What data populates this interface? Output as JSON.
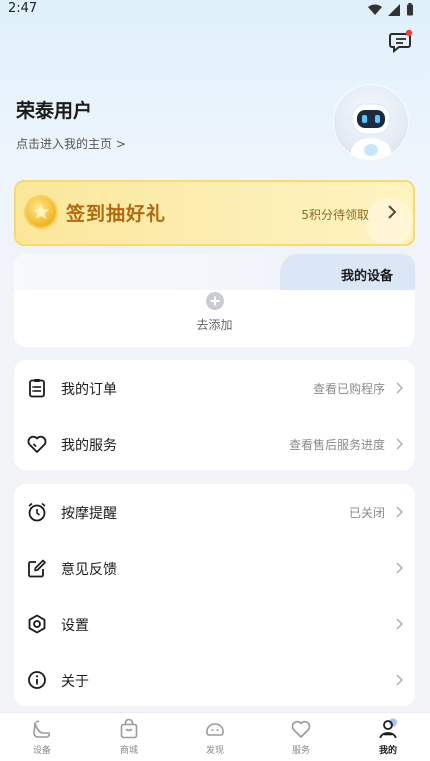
{
  "status_bar": {
    "time": "2:47"
  },
  "profile": {
    "name": "荣泰用户",
    "subtitle": "点击进入我的主页 >"
  },
  "signin": {
    "title": "签到抽好礼",
    "reward_text": "5积分待领取"
  },
  "devices": {
    "tab_label": "我的设备",
    "add_label": "去添加"
  },
  "group_orders": [
    {
      "label": "我的订单",
      "value": "查看已购程序",
      "icon": "clipboard-icon"
    },
    {
      "label": "我的服务",
      "value": "查看售后服务进度",
      "icon": "heart-icon"
    }
  ],
  "group_settings": [
    {
      "label": "按摩提醒",
      "value": "已关闭",
      "icon": "alarm-clock-icon"
    },
    {
      "label": "意见反馈",
      "value": "",
      "icon": "edit-icon"
    },
    {
      "label": "设置",
      "value": "",
      "icon": "hexagon-settings-icon"
    },
    {
      "label": "关于",
      "value": "",
      "icon": "info-icon"
    }
  ],
  "tabbar": [
    {
      "label": "设备",
      "icon": "device-icon"
    },
    {
      "label": "商城",
      "icon": "shop-bag-icon"
    },
    {
      "label": "发现",
      "icon": "discover-icon"
    },
    {
      "label": "服务",
      "icon": "service-heart-icon"
    },
    {
      "label": "我的",
      "icon": "profile-icon",
      "active": true
    }
  ],
  "colors": {
    "accent_gold": "#b3690e",
    "badge_red": "#ff3b30",
    "card_bg": "#ffffff"
  }
}
